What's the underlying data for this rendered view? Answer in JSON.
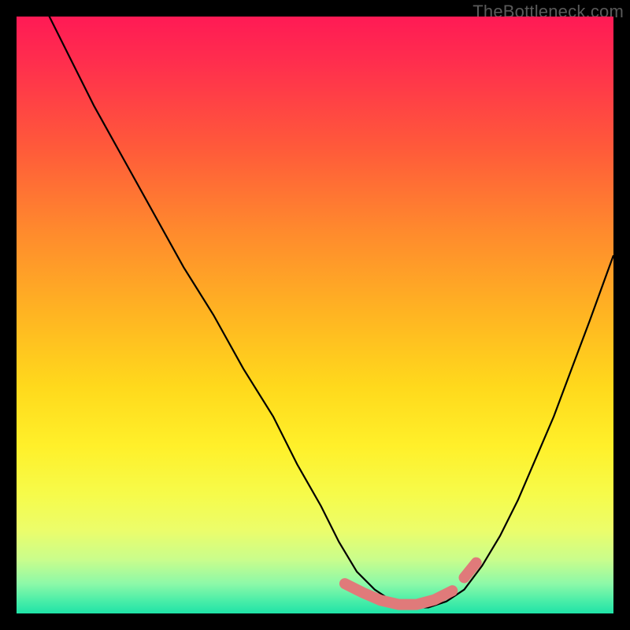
{
  "attribution": "TheBottleneck.com",
  "colors": {
    "curve_stroke": "#000000",
    "highlight_stroke": "#e07a7a",
    "background": "#000000"
  },
  "chart_data": {
    "type": "line",
    "title": "",
    "xlabel": "",
    "ylabel": "",
    "xlim": [
      0,
      100
    ],
    "ylim": [
      0,
      100
    ],
    "series": [
      {
        "name": "bottleneck-curve",
        "x": [
          0,
          2,
          5,
          9,
          13,
          18,
          23,
          28,
          33,
          38,
          43,
          47,
          51,
          54,
          57,
          60,
          63,
          66,
          69,
          72,
          75,
          78,
          81,
          84,
          87,
          90,
          93,
          96,
          100
        ],
        "y": [
          115,
          109,
          101,
          93,
          85,
          76,
          67,
          58,
          50,
          41,
          33,
          25,
          18,
          12,
          7,
          4,
          2,
          1,
          1,
          2,
          4,
          8,
          13,
          19,
          26,
          33,
          41,
          49,
          60
        ]
      }
    ],
    "annotations": [
      {
        "name": "highlight-bottom",
        "x": [
          55,
          58,
          61,
          64,
          67,
          70,
          73
        ],
        "y": [
          5,
          3.5,
          2.2,
          1.5,
          1.5,
          2.3,
          3.8
        ]
      },
      {
        "name": "highlight-right-segment",
        "x": [
          75,
          77
        ],
        "y": [
          6,
          8.5
        ]
      }
    ]
  }
}
